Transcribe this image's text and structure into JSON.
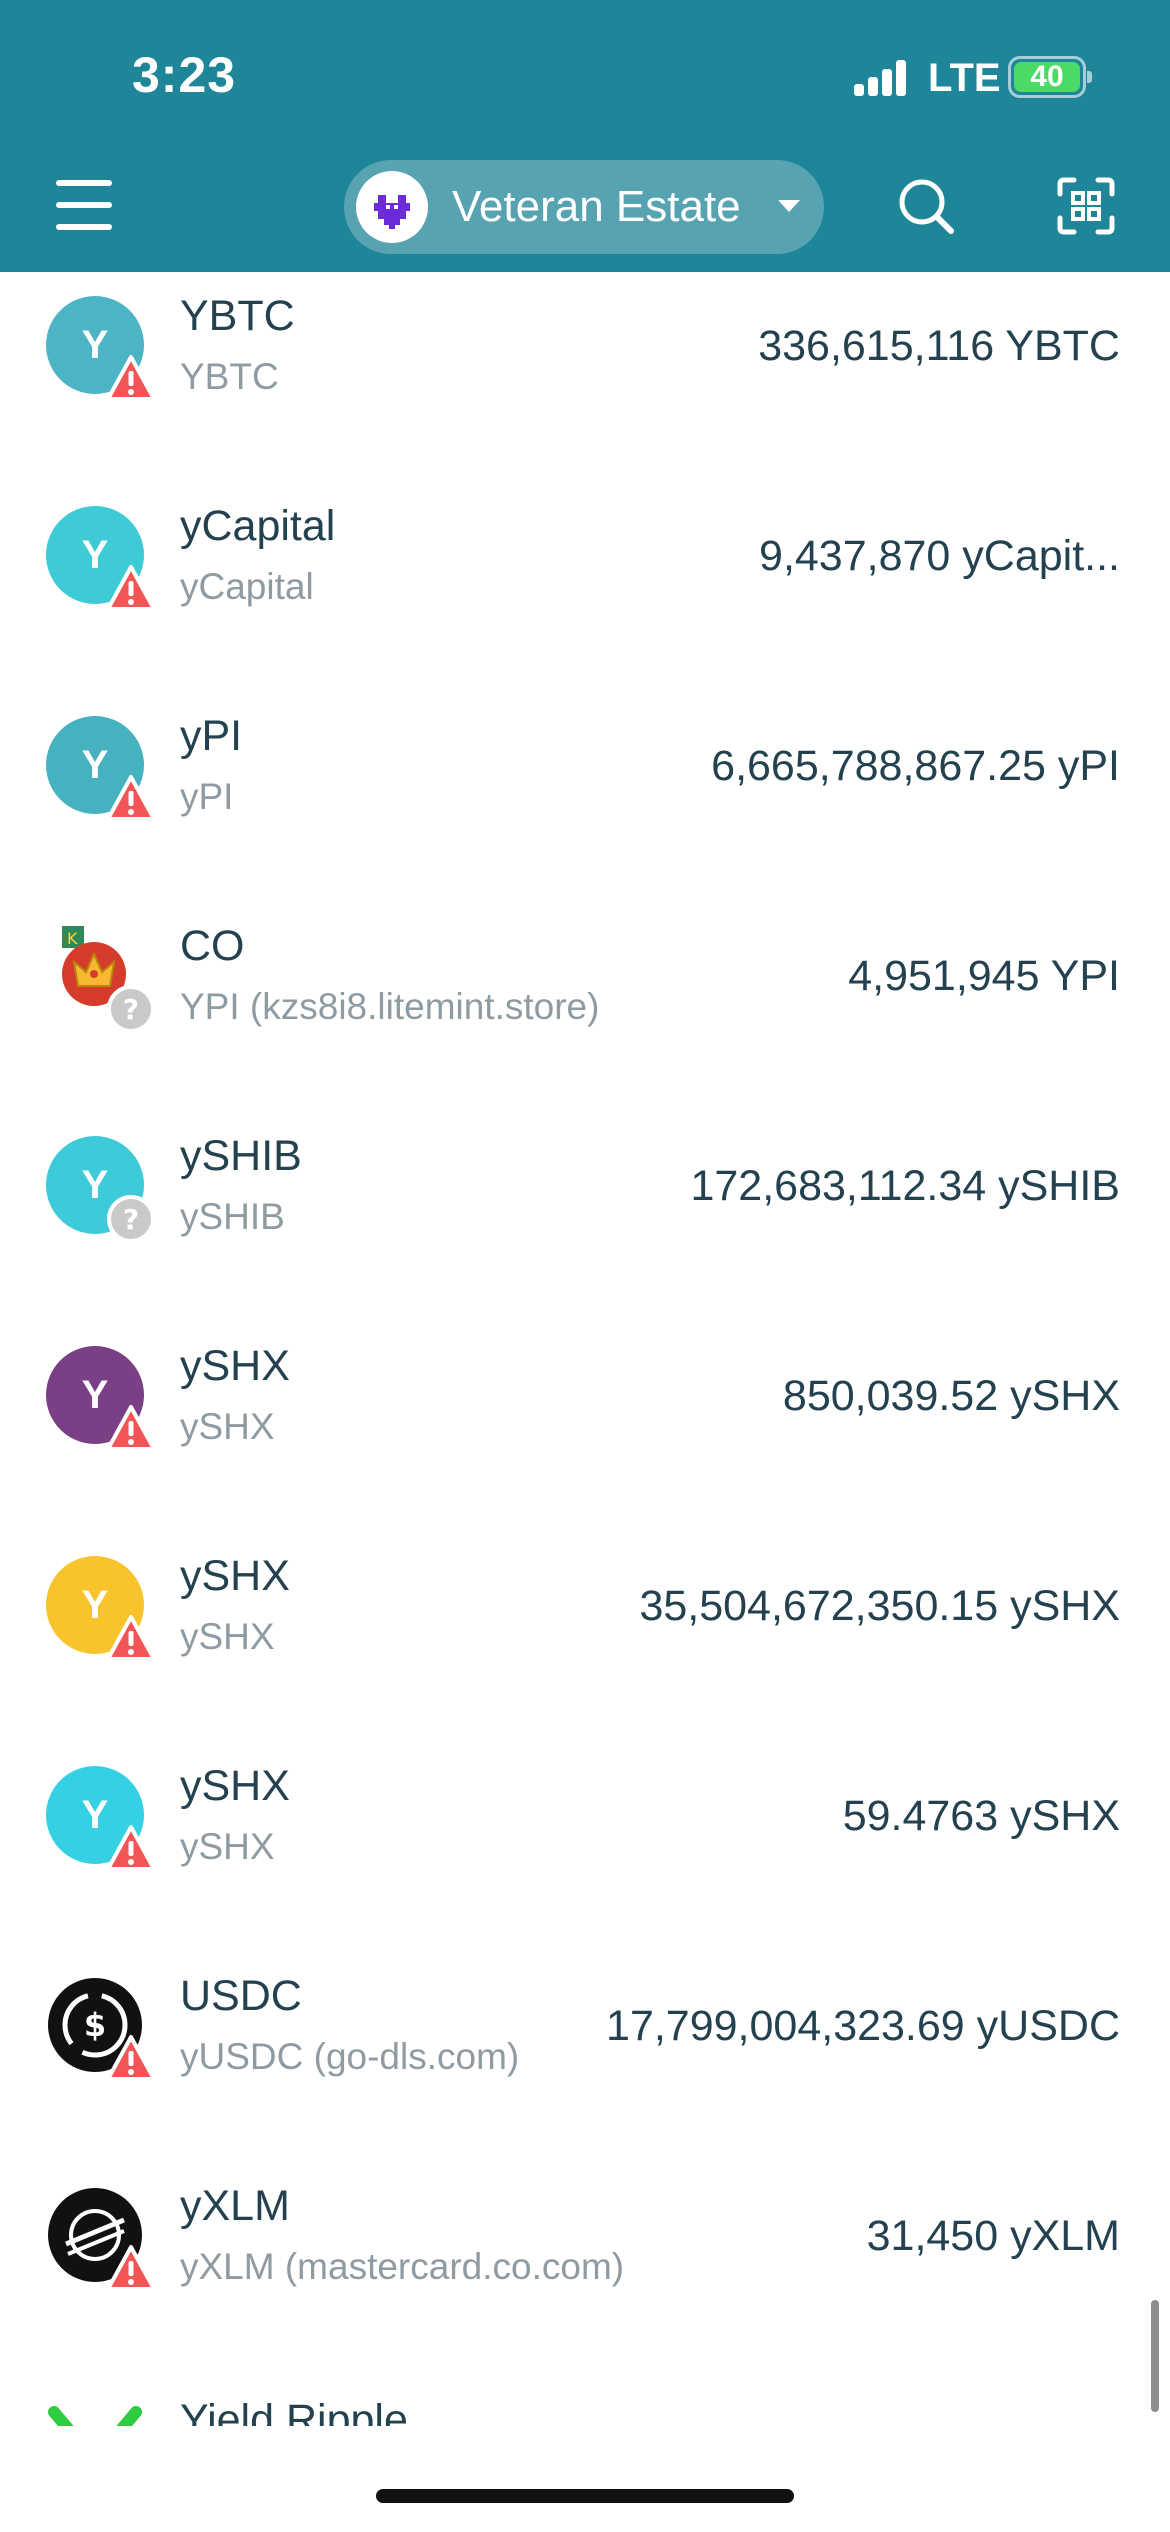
{
  "status_bar": {
    "time": "3:23",
    "network": "LTE",
    "battery": "40",
    "battery_color": "#4cd964"
  },
  "header": {
    "background": "#1f8599",
    "menu_icon": "hamburger-icon",
    "account_name": "Veteran Estate",
    "account_icon": "pixel-heart-icon",
    "search_icon": "search-icon",
    "scan_icon": "qr-scan-icon"
  },
  "assets": [
    {
      "name": "YBTC",
      "code": "YBTC",
      "balance": "336,615,116 YBTC",
      "icon_letter": "Y",
      "icon_color": "#4cb4c4",
      "badge": "warning"
    },
    {
      "name": "yCapital",
      "code": "yCapital",
      "balance": "9,437,870 yCapit...",
      "icon_letter": "Y",
      "icon_color": "#3ecbd6",
      "badge": "warning"
    },
    {
      "name": "yPI",
      "code": "yPI",
      "balance": "6,665,788,867.25 yPI",
      "icon_letter": "Y",
      "icon_color": "#47b2bf",
      "badge": "warning"
    },
    {
      "name": "CO",
      "code": "YPI (kzs8i8.litemint.store)",
      "balance": "4,951,945 YPI",
      "icon_letter": "",
      "icon_color": "#d63c2b",
      "icon_type": "crown",
      "badge": "unknown"
    },
    {
      "name": "ySHIB",
      "code": "ySHIB",
      "balance": "172,683,112.34 ySHIB",
      "icon_letter": "Y",
      "icon_color": "#3ecbd9",
      "badge": "unknown"
    },
    {
      "name": "ySHX",
      "code": "ySHX",
      "balance": "850,039.52 ySHX",
      "icon_letter": "Y",
      "icon_color": "#7b3f85",
      "badge": "warning"
    },
    {
      "name": "ySHX",
      "code": "ySHX",
      "balance": "35,504,672,350.15 ySHX",
      "icon_letter": "Y",
      "icon_color": "#f8c42e",
      "badge": "warning"
    },
    {
      "name": "ySHX",
      "code": "ySHX",
      "balance": "59.4763 ySHX",
      "icon_letter": "Y",
      "icon_color": "#36d0e4",
      "badge": "warning"
    },
    {
      "name": "USDC",
      "code": "yUSDC (go-dls.com)",
      "balance": "17,799,004,323.69 yUSDC",
      "icon_letter": "",
      "icon_color": "#111111",
      "icon_type": "usdc",
      "badge": "warning"
    },
    {
      "name": "yXLM",
      "code": "yXLM (mastercard.co.com)",
      "balance": "31,450 yXLM",
      "icon_letter": "",
      "icon_color": "#111111",
      "icon_type": "stellar",
      "badge": "warning"
    },
    {
      "name": "Yield Ripple",
      "code": "",
      "balance": "",
      "icon_letter": "",
      "icon_color": "#2ecc40",
      "icon_type": "ripple-x",
      "badge": "none"
    }
  ]
}
